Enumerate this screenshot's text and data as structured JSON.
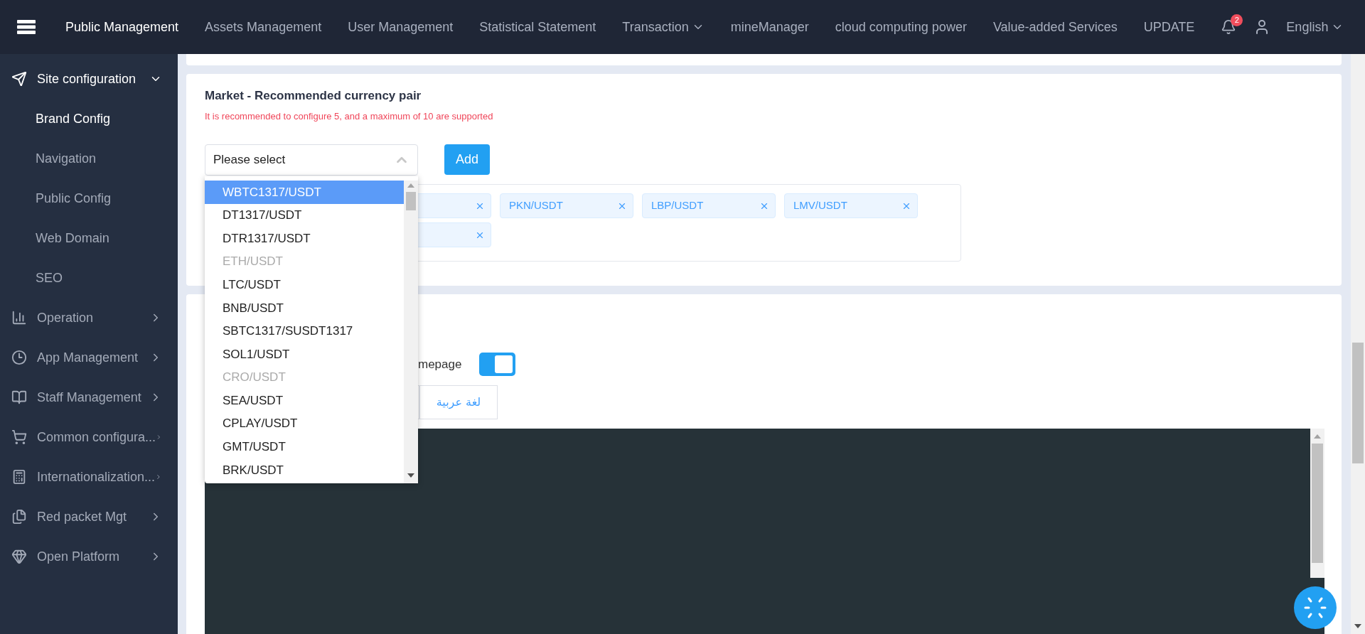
{
  "header": {
    "nav": [
      {
        "label": "Public Management",
        "selected": true,
        "has_caret": false
      },
      {
        "label": "Assets Management",
        "selected": false,
        "has_caret": false
      },
      {
        "label": "User Management",
        "selected": false,
        "has_caret": false
      },
      {
        "label": "Statistical Statement",
        "selected": false,
        "has_caret": false
      },
      {
        "label": "Transaction",
        "selected": false,
        "has_caret": true
      },
      {
        "label": "mineManager",
        "selected": false,
        "has_caret": false
      },
      {
        "label": "cloud computing power",
        "selected": false,
        "has_caret": false
      },
      {
        "label": "Value-added Services",
        "selected": false,
        "has_caret": false
      },
      {
        "label": "UPDATE",
        "selected": false,
        "has_caret": false
      }
    ],
    "notification_count": "2",
    "language": "English"
  },
  "sidebar": {
    "items": [
      {
        "label": "Site configuration",
        "expanded": true,
        "children": [
          {
            "label": "Brand Config",
            "selected": true
          },
          {
            "label": "Navigation",
            "selected": false
          },
          {
            "label": "Public Config",
            "selected": false
          },
          {
            "label": "Web Domain",
            "selected": false
          },
          {
            "label": "SEO",
            "selected": false
          }
        ]
      },
      {
        "label": "Operation",
        "expanded": false
      },
      {
        "label": "App Management",
        "expanded": false
      },
      {
        "label": "Staff Management",
        "expanded": false
      },
      {
        "label": "Common configura...",
        "expanded": false
      },
      {
        "label": "Internationalization...",
        "expanded": false
      },
      {
        "label": "Red packet Mgt",
        "expanded": false
      },
      {
        "label": "Open Platform",
        "expanded": false
      }
    ]
  },
  "market_card": {
    "title": "Market - Recommended currency pair",
    "hint": "It is recommended to configure 5, and a maximum of 10 are supported",
    "select": {
      "placeholder": "Please select",
      "expanded": true,
      "options": [
        {
          "label": "WBTC1317/USDT",
          "selected": true,
          "disabled": false
        },
        {
          "label": "DT1317/USDT",
          "selected": false,
          "disabled": false
        },
        {
          "label": "DTR1317/USDT",
          "selected": false,
          "disabled": false
        },
        {
          "label": "ETH/USDT",
          "selected": false,
          "disabled": true
        },
        {
          "label": "LTC/USDT",
          "selected": false,
          "disabled": false
        },
        {
          "label": "BNB/USDT",
          "selected": false,
          "disabled": false
        },
        {
          "label": "SBTC1317/SUSDT1317",
          "selected": false,
          "disabled": false
        },
        {
          "label": "SOL1/USDT",
          "selected": false,
          "disabled": false
        },
        {
          "label": "CRO/USDT",
          "selected": false,
          "disabled": true
        },
        {
          "label": "SEA/USDT",
          "selected": false,
          "disabled": false
        },
        {
          "label": "CPLAY/USDT",
          "selected": false,
          "disabled": false
        },
        {
          "label": "GMT/USDT",
          "selected": false,
          "disabled": false
        },
        {
          "label": "BRK/USDT",
          "selected": false,
          "disabled": false
        }
      ]
    },
    "add_button": "Add",
    "tags": [
      {
        "kind": "covered"
      },
      {
        "kind": "tag",
        "label": "PKN/USDT"
      },
      {
        "kind": "tag",
        "label": "LBP/USDT"
      },
      {
        "kind": "tag",
        "label": "LMV/USDT"
      },
      {
        "kind": "covered"
      }
    ]
  },
  "homepage_card": {
    "switch": {
      "label": "mepage",
      "on": true
    },
    "language_buttons": [
      {
        "kind": "covered"
      },
      {
        "kind": "button",
        "label": "لغة عربية"
      }
    ]
  }
}
